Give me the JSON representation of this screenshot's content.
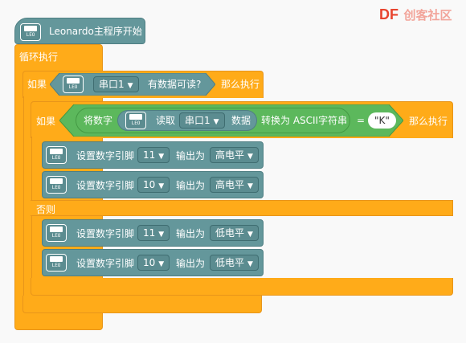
{
  "logo": {
    "brand": "DF",
    "suffix": "创客社区"
  },
  "hat": {
    "label": "Leonardo主程序开始",
    "board_label": "LEO"
  },
  "forever": {
    "label": "循环执行"
  },
  "if_outer": {
    "if_label": "如果",
    "serial_port": "串口1",
    "condition_text": "有数据可读?",
    "then_label": "那么执行"
  },
  "if_inner": {
    "if_label": "如果",
    "convert_label": "将数字",
    "read_label": "读取",
    "serial_port": "串口1",
    "data_label": "数据",
    "to_ascii_label": "转换为 ASCII字符串",
    "equals_label": "=",
    "compare_value": "\"K\"",
    "then_label": "那么执行",
    "else_label": "否则"
  },
  "set_pin_label": "设置数字引脚",
  "output_as_label": "输出为",
  "caret": "▼",
  "then_blocks": [
    {
      "pin": "11",
      "level": "高电平"
    },
    {
      "pin": "10",
      "level": "高电平"
    }
  ],
  "else_blocks": [
    {
      "pin": "11",
      "level": "低电平"
    },
    {
      "pin": "10",
      "level": "低电平"
    }
  ],
  "colors": {
    "control": "#ffab19",
    "device": "#64979b",
    "operator": "#5cb85c",
    "logo_red": "#e8442e"
  }
}
